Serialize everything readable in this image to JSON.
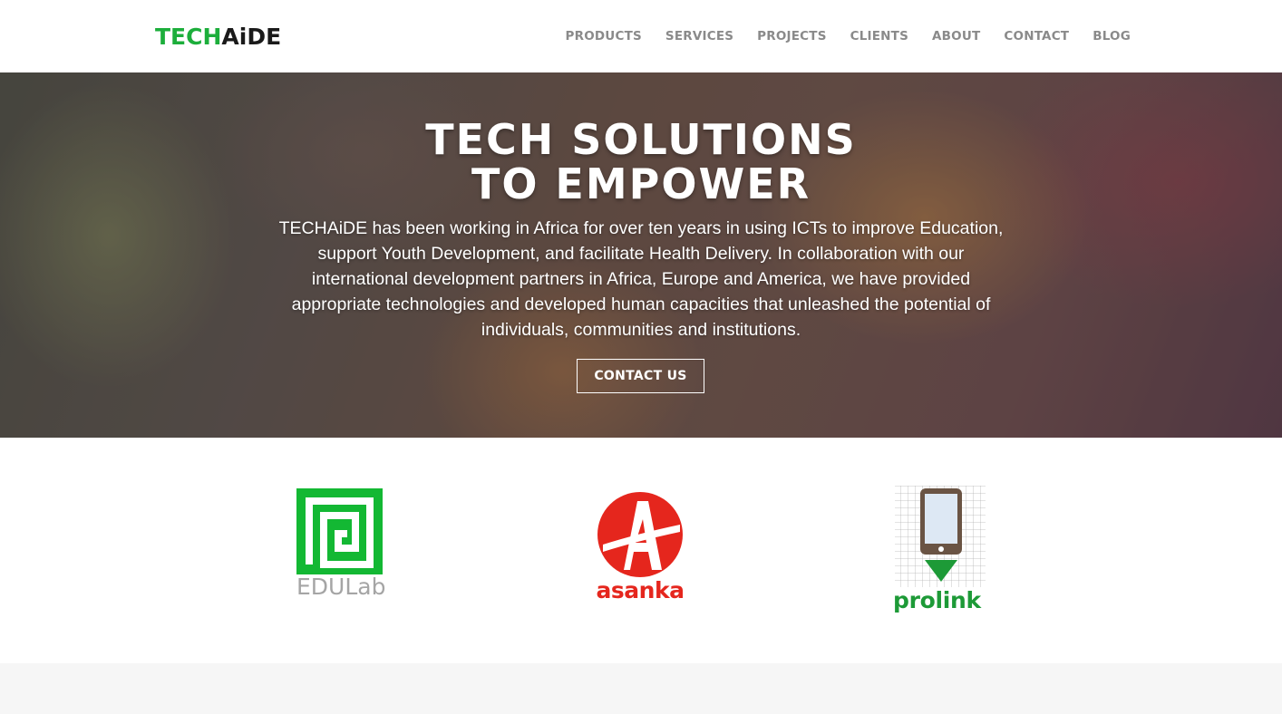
{
  "header": {
    "logo": {
      "part1": "TECH",
      "part2": "AiDE"
    },
    "nav": [
      {
        "label": "PRODUCTS"
      },
      {
        "label": "SERVICES"
      },
      {
        "label": "PROJECTS"
      },
      {
        "label": "CLIENTS"
      },
      {
        "label": "ABOUT"
      },
      {
        "label": "CONTACT"
      },
      {
        "label": "BLOG"
      }
    ]
  },
  "hero": {
    "title_line1": "TECH SOLUTIONS",
    "title_line2": "TO EMPOWER",
    "text": "TECHAiDE has been working in Africa for over ten years in using ICTs to improve Education, support Youth Development, and facilitate Health Delivery. In collaboration with our international development partners in Africa, Europe and America, we have provided appropriate technologies and developed human capacities that unleashed the potential of individuals, communities and institutions.",
    "button_label": "CONTACT US"
  },
  "products": [
    {
      "name": "EDULab"
    },
    {
      "name": "asanka"
    },
    {
      "name": "prolink"
    }
  ],
  "colors": {
    "brand_green": "#1cae3b",
    "edulab_green": "#13b833",
    "asanka_red": "#e5261d",
    "prolink_green": "#1d9a37"
  }
}
